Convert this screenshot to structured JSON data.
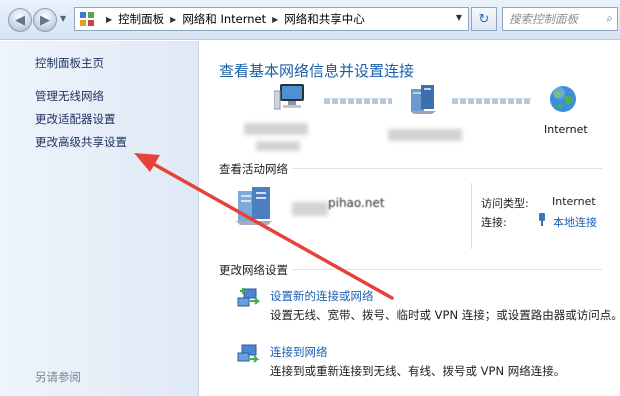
{
  "address_bar": {
    "crumbs": [
      "控制面板",
      "网络和 Internet",
      "网络和共享中心"
    ],
    "search_placeholder": "搜索控制面板"
  },
  "sidebar": {
    "home": "控制面板主页",
    "links": [
      "管理无线网络",
      "更改适配器设置",
      "更改高级共享设置"
    ],
    "see_also": "另请参阅"
  },
  "main": {
    "title": "查看基本网络信息并设置连接",
    "internet_label": "Internet",
    "active_section": "查看活动网络",
    "network_name_partial": "pihao.net",
    "access_type_label": "访问类型:",
    "access_type_value": "Internet",
    "connection_label": "连接:",
    "connection_value": "本地连接",
    "change_section": "更改网络设置",
    "tasks": [
      {
        "link": "设置新的连接或网络",
        "desc": "设置无线、宽带、拨号、临时或 VPN 连接；或设置路由器或访问点。"
      },
      {
        "link": "连接到网络",
        "desc": "连接到或重新连接到无线、有线、拨号或 VPN 网络连接。"
      }
    ]
  },
  "colors": {
    "link": "#1a5fb4",
    "title": "#1b5fa8",
    "annotation_arrow": "#e8413a"
  }
}
